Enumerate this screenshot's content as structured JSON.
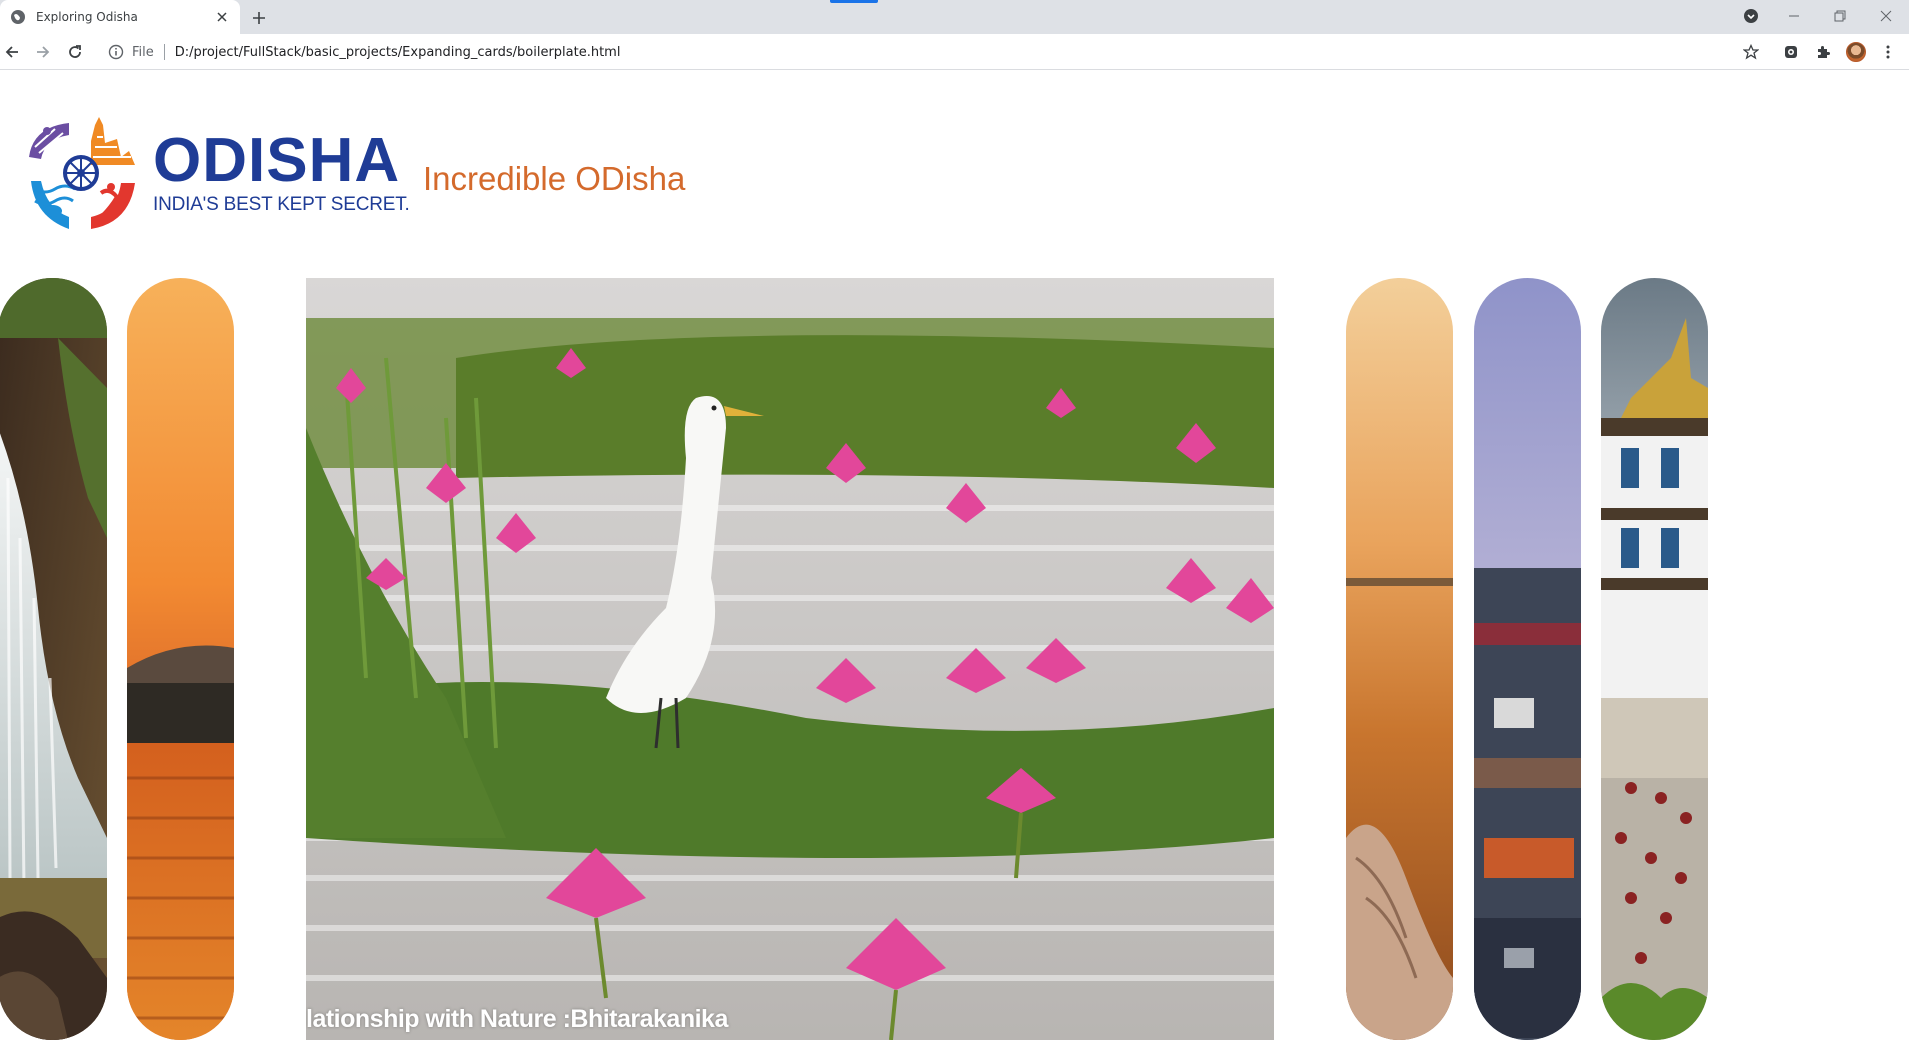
{
  "browser": {
    "tab_title": "Exploring Odisha",
    "scheme_label": "File",
    "url": "D:/project/FullStack/basic_projects/Expanding_cards/boilerplate.html"
  },
  "header": {
    "logo_word": "ODISHA",
    "logo_tagline": "INDIA'S BEST KEPT SECRET.",
    "headline": "Incredible ODisha"
  },
  "cards": [
    {
      "name": "waterfall",
      "caption": ""
    },
    {
      "name": "sunset-lake",
      "caption": ""
    },
    {
      "name": "bhitarakanika",
      "caption": "lationship with Nature :Bhitarakanika"
    },
    {
      "name": "beach-sunset",
      "caption": ""
    },
    {
      "name": "town-view",
      "caption": ""
    },
    {
      "name": "monastery",
      "caption": ""
    }
  ],
  "colors": {
    "brand_blue": "#1f3c96",
    "headline_orange": "#d46a2c"
  },
  "icons": [
    "globe-icon",
    "close-icon",
    "plus-icon",
    "back-icon",
    "forward-icon",
    "reload-icon",
    "info-icon",
    "star-icon",
    "extension-icon",
    "puzzle-icon",
    "menu-icon"
  ]
}
